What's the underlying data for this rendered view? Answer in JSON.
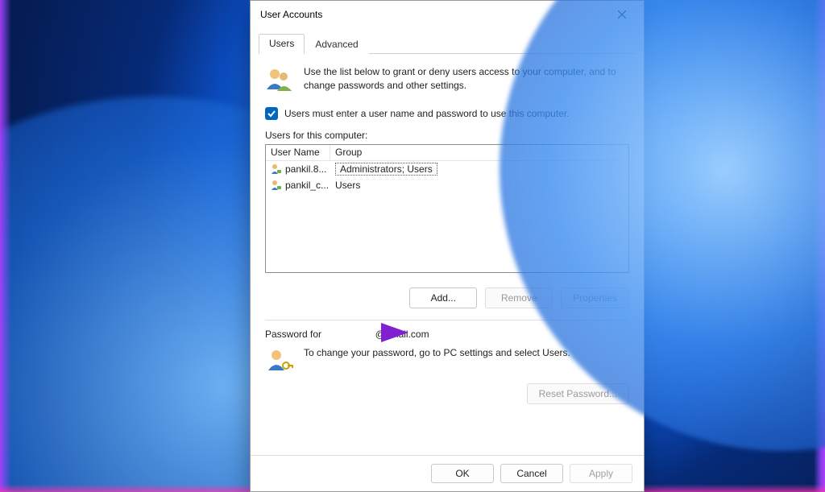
{
  "window": {
    "title": "User Accounts"
  },
  "tabs": {
    "users": "Users",
    "advanced": "Advanced"
  },
  "intro": "Use the list below to grant or deny users access to your computer, and to change passwords and other settings.",
  "require_login_label": "Users must enter a user name and password to use this computer.",
  "users_list_label": "Users for this computer:",
  "users_columns": {
    "username": "User Name",
    "group": "Group"
  },
  "users_rows": [
    {
      "username": "pankil.8...",
      "group": "Administrators; Users"
    },
    {
      "username": "pankil_c...",
      "group": "Users"
    }
  ],
  "buttons": {
    "add": "Add...",
    "remove": "Remove",
    "properties": "Properties",
    "reset_password": "Reset Password...",
    "ok": "OK",
    "cancel": "Cancel",
    "apply": "Apply"
  },
  "password_section": {
    "prefix": "Password for",
    "account_suffix": "@gmail.com",
    "text": "To change your password, go to PC settings and select Users."
  }
}
